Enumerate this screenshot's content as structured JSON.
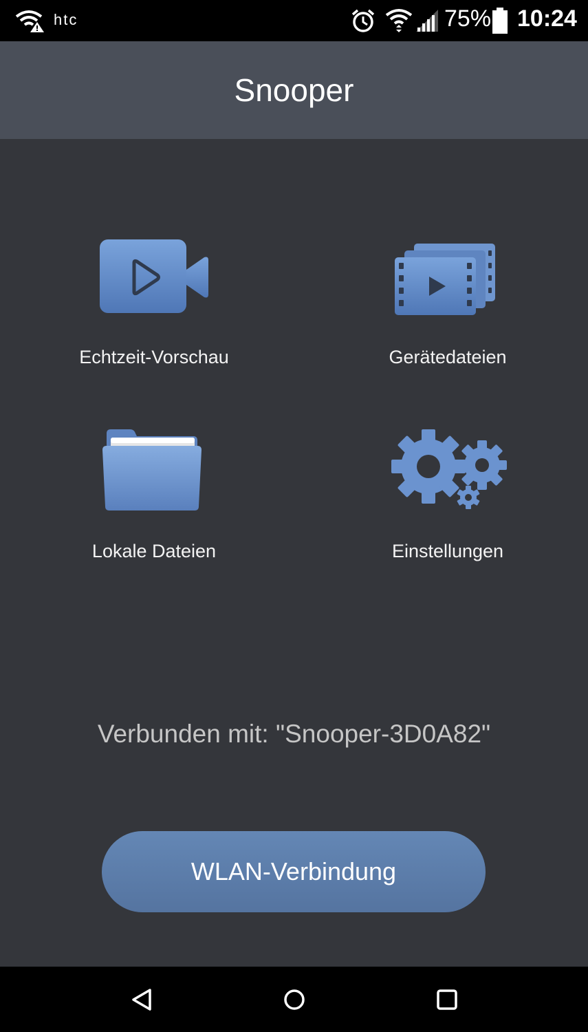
{
  "status_bar": {
    "carrier": "htc",
    "battery_percent": "75%",
    "time": "10:24",
    "icons": [
      "wifi-warning-icon",
      "alarm-icon",
      "wifi-icon",
      "signal-icon",
      "battery-icon"
    ]
  },
  "app_bar": {
    "title": "Snooper"
  },
  "menu": {
    "live_preview": {
      "label": "Echtzeit-Vorschau",
      "icon": "video-camera-icon"
    },
    "device_files": {
      "label": "Gerätedateien",
      "icon": "video-files-icon"
    },
    "local_files": {
      "label": "Lokale Dateien",
      "icon": "folder-icon"
    },
    "settings": {
      "label": "Einstellungen",
      "icon": "gears-icon"
    }
  },
  "connection": {
    "status_text": "Verbunden mit: \"Snooper-3D0A82\""
  },
  "wlan_button": {
    "label": "WLAN-Verbindung"
  },
  "nav_bar": {
    "icons": [
      "back-icon",
      "home-icon",
      "recents-icon"
    ]
  },
  "colors": {
    "background": "#34363b",
    "app_bar": "#4a4f59",
    "icon_blue": "#6b93cf",
    "button": "#5f80ad"
  }
}
